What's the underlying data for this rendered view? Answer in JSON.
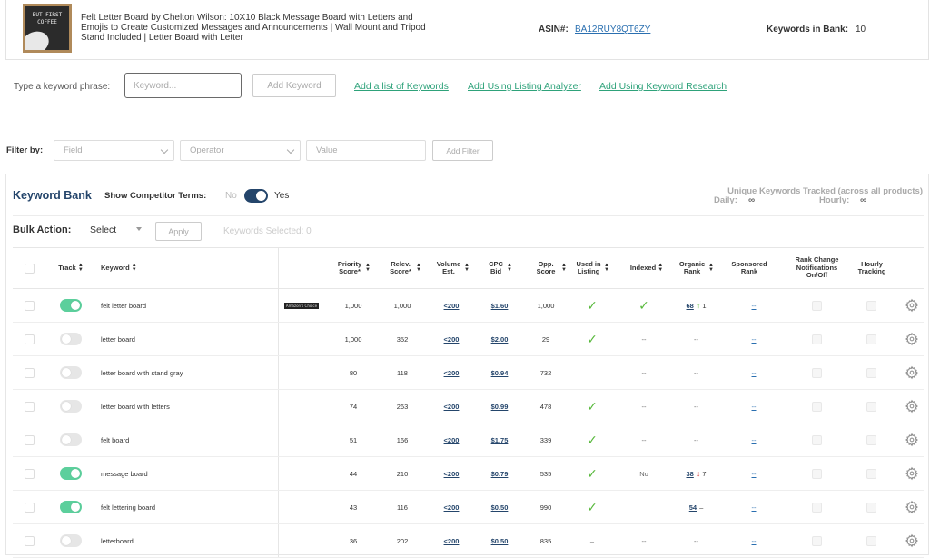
{
  "product": {
    "image_text": "BUT FIRST COFFEE",
    "title": "Felt Letter Board by Chelton Wilson: 10X10 Black Message Board with Letters and Emojis to Create Customized Messages and Announcements | Wall Mount and Tripod Stand Included | Letter Board with Letter",
    "asin_label": "ASIN#:",
    "asin": "BA12RUY8QT6ZY",
    "bank_label": "Keywords in Bank:",
    "bank_count": "10"
  },
  "add_keyword": {
    "label": "Type a keyword phrase:",
    "placeholder": "Keyword...",
    "button": "Add Keyword",
    "links": [
      "Add a list of Keywords",
      "Add Using Listing Analyzer",
      "Add Using Keyword Research"
    ]
  },
  "filter": {
    "label": "Filter by:",
    "field_placeholder": "Field",
    "operator_placeholder": "Operator",
    "value_placeholder": "Value",
    "button": "Add Filter"
  },
  "bank": {
    "title": "Keyword Bank",
    "competitor_label": "Show Competitor Terms:",
    "no": "No",
    "yes": "Yes",
    "unique_title": "Unique Keywords Tracked (across all products)",
    "daily_label": "Daily:",
    "daily_value": "∞",
    "hourly_label": "Hourly:",
    "hourly_value": "∞",
    "bulk_label": "Bulk Action:",
    "bulk_select": "Select",
    "apply": "Apply",
    "selected": "Keywords Selected: 0"
  },
  "columns": {
    "track": "Track",
    "keyword": "Keyword",
    "priority": "Priority Score*",
    "relev": "Relev. Score*",
    "volume": "Volume Est.",
    "cpc": "CPC Bid",
    "opp": "Opp. Score",
    "used": "Used in Listing",
    "indexed": "Indexed",
    "organic": "Organic Rank",
    "sponsored": "Sponsored Rank",
    "rank_change": "Rank Change Notifications On/Off",
    "hourly": "Hourly Tracking"
  },
  "rows": [
    {
      "track": true,
      "keyword": "felt letter board",
      "badge": "Amazon's Choice",
      "priority": "1,000",
      "relev": "1,000",
      "volume": "<200",
      "cpc": "$1.60",
      "opp": "1,000",
      "used": true,
      "indexed": "check",
      "organic": "68",
      "organic_dir": "up",
      "organic_delta": "1",
      "sponsored": "--"
    },
    {
      "track": false,
      "keyword": "letter board",
      "badge": "",
      "priority": "1,000",
      "relev": "352",
      "volume": "<200",
      "cpc": "$2.00",
      "opp": "29",
      "used": true,
      "indexed": "--",
      "organic": "--",
      "organic_dir": "",
      "organic_delta": "",
      "sponsored": "--"
    },
    {
      "track": false,
      "keyword": "letter board with stand gray",
      "badge": "",
      "priority": "80",
      "relev": "118",
      "volume": "<200",
      "cpc": "$0.94",
      "opp": "732",
      "used": false,
      "indexed": "--",
      "organic": "--",
      "organic_dir": "",
      "organic_delta": "",
      "sponsored": "--"
    },
    {
      "track": false,
      "keyword": "letter board with letters",
      "badge": "",
      "priority": "74",
      "relev": "263",
      "volume": "<200",
      "cpc": "$0.99",
      "opp": "478",
      "used": true,
      "indexed": "--",
      "organic": "--",
      "organic_dir": "",
      "organic_delta": "",
      "sponsored": "--"
    },
    {
      "track": false,
      "keyword": "felt board",
      "badge": "",
      "priority": "51",
      "relev": "166",
      "volume": "<200",
      "cpc": "$1.75",
      "opp": "339",
      "used": true,
      "indexed": "--",
      "organic": "--",
      "organic_dir": "",
      "organic_delta": "",
      "sponsored": "--"
    },
    {
      "track": true,
      "keyword": "message board",
      "badge": "",
      "priority": "44",
      "relev": "210",
      "volume": "<200",
      "cpc": "$0.79",
      "opp": "535",
      "used": true,
      "indexed": "No",
      "organic": "38",
      "organic_dir": "down",
      "organic_delta": "7",
      "sponsored": "--"
    },
    {
      "track": true,
      "keyword": "felt lettering board",
      "badge": "",
      "priority": "43",
      "relev": "116",
      "volume": "<200",
      "cpc": "$0.50",
      "opp": "990",
      "used": true,
      "indexed": "",
      "organic": "54",
      "organic_dir": "flat",
      "organic_delta": "",
      "sponsored": "--"
    },
    {
      "track": false,
      "keyword": "letterboard",
      "badge": "",
      "priority": "36",
      "relev": "202",
      "volume": "<200",
      "cpc": "$0.50",
      "opp": "835",
      "used": false,
      "indexed": "--",
      "organic": "--",
      "organic_dir": "",
      "organic_delta": "",
      "sponsored": "--"
    }
  ],
  "colors": {
    "accent_green": "#2ea27a",
    "toggle_on": "#5ccf9c",
    "navy": "#24456b",
    "check": "#56b83a"
  }
}
